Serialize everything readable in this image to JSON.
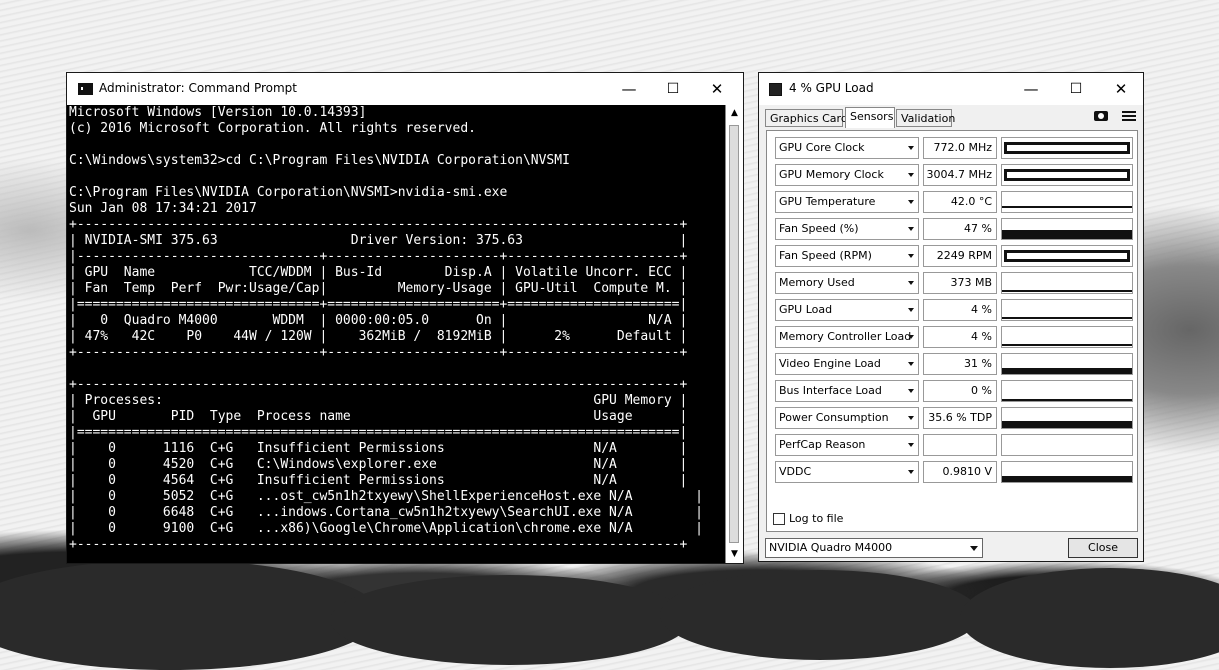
{
  "cmd": {
    "title": "Administrator: Command Prompt",
    "minimize": "—",
    "maximize": "☐",
    "close": "✕",
    "lines": [
      "Microsoft Windows [Version 10.0.14393]",
      "(c) 2016 Microsoft Corporation. All rights reserved.",
      "",
      "C:\\Windows\\system32>cd C:\\Program Files\\NVIDIA Corporation\\NVSMI",
      "",
      "C:\\Program Files\\NVIDIA Corporation\\NVSMI>nvidia-smi.exe",
      "Sun Jan 08 17:34:21 2017",
      "+-----------------------------------------------------------------------------+",
      "| NVIDIA-SMI 375.63                 Driver Version: 375.63                    |",
      "|-------------------------------+----------------------+----------------------+",
      "| GPU  Name            TCC/WDDM | Bus-Id        Disp.A | Volatile Uncorr. ECC |",
      "| Fan  Temp  Perf  Pwr:Usage/Cap|         Memory-Usage | GPU-Util  Compute M. |",
      "|===============================+======================+======================|",
      "|   0  Quadro M4000       WDDM  | 0000:00:05.0      On |                  N/A |",
      "| 47%   42C    P0    44W / 120W |    362MiB /  8192MiB |      2%      Default |",
      "+-------------------------------+----------------------+----------------------+",
      "",
      "+-----------------------------------------------------------------------------+",
      "| Processes:                                                       GPU Memory |",
      "|  GPU       PID  Type  Process name                               Usage      |",
      "|=============================================================================|",
      "|    0      1116  C+G   Insufficient Permissions                   N/A        |",
      "|    0      4520  C+G   C:\\Windows\\explorer.exe                    N/A        |",
      "|    0      4564  C+G   Insufficient Permissions                   N/A        |",
      "|    0      5052  C+G   ...ost_cw5n1h2txyewy\\ShellExperienceHost.exe N/A        |",
      "|    0      6648  C+G   ...indows.Cortana_cw5n1h2txyewy\\SearchUI.exe N/A        |",
      "|    0      9100  C+G   ...x86)\\Google\\Chrome\\Application\\chrome.exe N/A        |",
      "+-----------------------------------------------------------------------------+"
    ]
  },
  "gpuz": {
    "title": "4 % GPU Load",
    "minimize": "—",
    "maximize": "☐",
    "close": "✕",
    "tabs": [
      "Graphics Card",
      "Sensors",
      "Validation"
    ],
    "active_tab": "Sensors",
    "sensors": [
      {
        "name": "GPU Core Clock",
        "value": "772.0 MHz",
        "level": 1.0,
        "style": "bar"
      },
      {
        "name": "GPU Memory Clock",
        "value": "3004.7 MHz",
        "level": 1.0,
        "style": "bar"
      },
      {
        "name": "GPU Temperature",
        "value": "42.0 °C",
        "level": 0.18,
        "style": "line"
      },
      {
        "name": "Fan Speed (%)",
        "value": "47 %",
        "level": 0.47,
        "style": "solid"
      },
      {
        "name": "Fan Speed (RPM)",
        "value": "2249 RPM",
        "level": 1.0,
        "style": "bar"
      },
      {
        "name": "Memory Used",
        "value": "373 MB",
        "level": 0.05,
        "style": "line"
      },
      {
        "name": "GPU Load",
        "value": "4 %",
        "level": 0.04,
        "style": "line"
      },
      {
        "name": "Memory Controller Load",
        "value": "4 %",
        "level": 0.04,
        "style": "line"
      },
      {
        "name": "Video Engine Load",
        "value": "31 %",
        "level": 0.31,
        "style": "solid"
      },
      {
        "name": "Bus Interface Load",
        "value": "0 %",
        "level": 0.0,
        "style": "line"
      },
      {
        "name": "Power Consumption",
        "value": "35.6 % TDP",
        "level": 0.36,
        "style": "solid"
      },
      {
        "name": "PerfCap Reason",
        "value": "",
        "level": 0.0,
        "style": "none"
      },
      {
        "name": "VDDC",
        "value": "0.9810 V",
        "level": 0.3,
        "style": "solid"
      }
    ],
    "log_to_file": "Log to file",
    "gpu_select": "NVIDIA Quadro M4000",
    "close_button": "Close"
  }
}
